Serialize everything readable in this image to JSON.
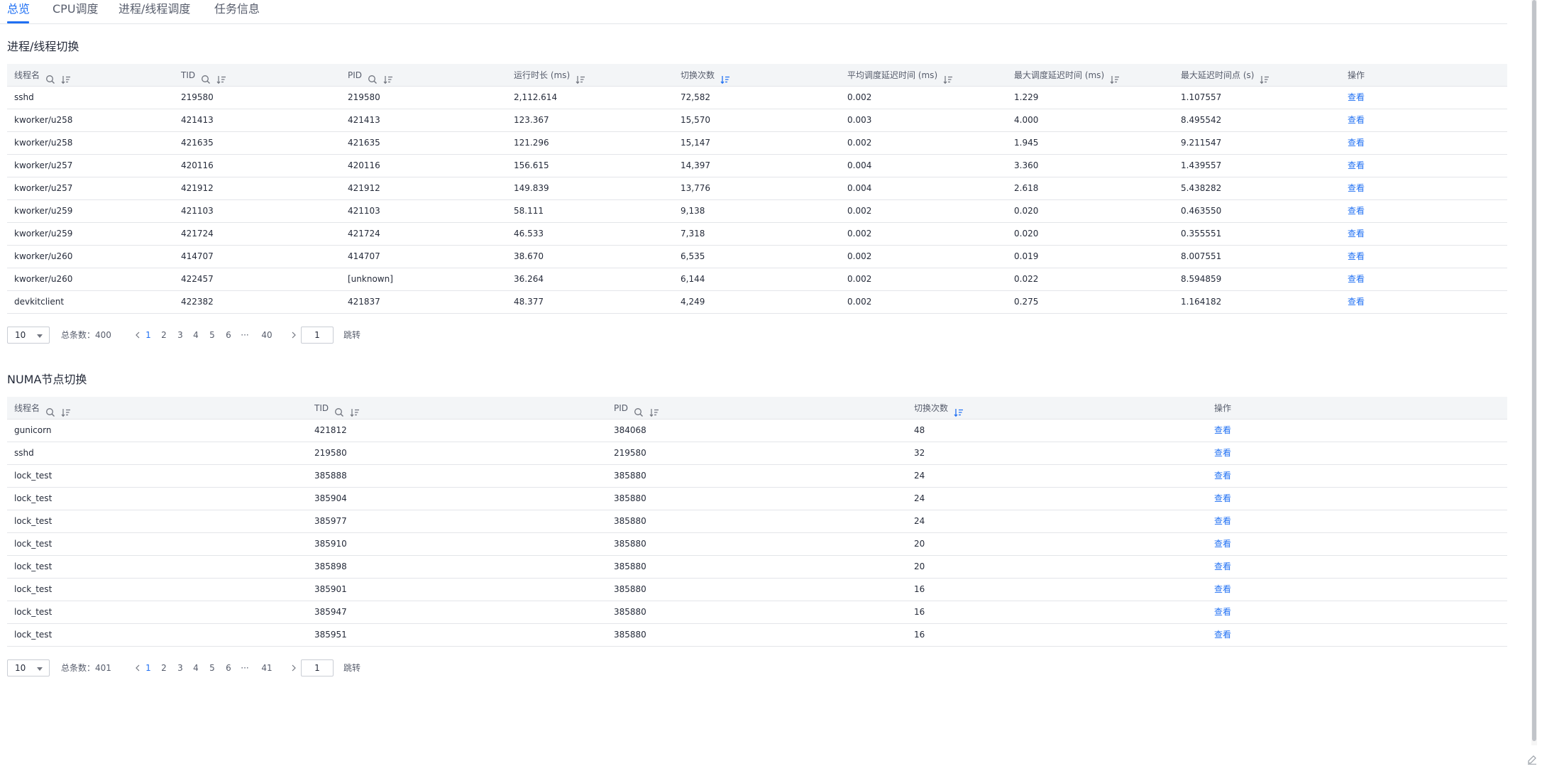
{
  "tabs": [
    {
      "label": "总览",
      "active": true
    },
    {
      "label": "CPU调度",
      "active": false
    },
    {
      "label": "进程/线程调度",
      "active": false
    },
    {
      "label": "任务信息",
      "active": false
    }
  ],
  "colors": {
    "accent": "#2070f3",
    "header_bg": "#f3f5f7",
    "border": "#e3e5e9",
    "text": "#252b3a",
    "muted": "#575d6c"
  },
  "switch_section": {
    "title": "进程/线程切换",
    "columns": [
      {
        "label": "线程名",
        "icons": [
          "search-icon",
          "sort-icon"
        ]
      },
      {
        "label": "TID",
        "icons": [
          "search-icon",
          "sort-icon"
        ]
      },
      {
        "label": "PID",
        "icons": [
          "search-icon",
          "sort-icon"
        ]
      },
      {
        "label": "运行时长 (ms)",
        "icons": [
          "sort-icon"
        ]
      },
      {
        "label": "切换次数",
        "icons": [
          "sort-desc-active-icon"
        ]
      },
      {
        "label": "平均调度延迟时间 (ms)",
        "icons": [
          "sort-icon"
        ]
      },
      {
        "label": "最大调度延迟时间 (ms)",
        "icons": [
          "sort-icon"
        ]
      },
      {
        "label": "最大延迟时间点 (s)",
        "icons": [
          "sort-icon"
        ]
      },
      {
        "label": "操作",
        "icons": []
      }
    ],
    "rows": [
      [
        "sshd",
        "219580",
        "219580",
        "2,112.614",
        "72,582",
        "0.002",
        "1.229",
        "1.107557",
        "查看"
      ],
      [
        "kworker/u258",
        "421413",
        "421413",
        "123.367",
        "15,570",
        "0.003",
        "4.000",
        "8.495542",
        "查看"
      ],
      [
        "kworker/u258",
        "421635",
        "421635",
        "121.296",
        "15,147",
        "0.002",
        "1.945",
        "9.211547",
        "查看"
      ],
      [
        "kworker/u257",
        "420116",
        "420116",
        "156.615",
        "14,397",
        "0.004",
        "3.360",
        "1.439557",
        "查看"
      ],
      [
        "kworker/u257",
        "421912",
        "421912",
        "149.839",
        "13,776",
        "0.004",
        "2.618",
        "5.438282",
        "查看"
      ],
      [
        "kworker/u259",
        "421103",
        "421103",
        "58.111",
        "9,138",
        "0.002",
        "0.020",
        "0.463550",
        "查看"
      ],
      [
        "kworker/u259",
        "421724",
        "421724",
        "46.533",
        "7,318",
        "0.002",
        "0.020",
        "0.355551",
        "查看"
      ],
      [
        "kworker/u260",
        "414707",
        "414707",
        "38.670",
        "6,535",
        "0.002",
        "0.019",
        "8.007551",
        "查看"
      ],
      [
        "kworker/u260",
        "422457",
        "[unknown]",
        "36.264",
        "6,144",
        "0.002",
        "0.022",
        "8.594859",
        "查看"
      ],
      [
        "devkitclient",
        "422382",
        "421837",
        "48.377",
        "4,249",
        "0.002",
        "0.275",
        "1.164182",
        "查看"
      ]
    ],
    "pager": {
      "page_size": "10",
      "total_label": "总条数：400",
      "prev_icon": "chevron-left-icon",
      "next_icon": "chevron-right-icon",
      "pages": [
        "1",
        "2",
        "3",
        "4",
        "5",
        "6",
        "···",
        "40"
      ],
      "jump_value": "1",
      "jump_label": "跳转"
    }
  },
  "numa_section": {
    "title": "NUMA节点切换",
    "columns": [
      {
        "label": "线程名",
        "icons": [
          "search-icon",
          "sort-icon"
        ]
      },
      {
        "label": "TID",
        "icons": [
          "search-icon",
          "sort-icon"
        ]
      },
      {
        "label": "PID",
        "icons": [
          "search-icon",
          "sort-icon"
        ]
      },
      {
        "label": "切换次数",
        "icons": [
          "sort-desc-active-icon"
        ]
      },
      {
        "label": "操作",
        "icons": []
      }
    ],
    "rows": [
      [
        "gunicorn",
        "421812",
        "384068",
        "48",
        "查看"
      ],
      [
        "sshd",
        "219580",
        "219580",
        "32",
        "查看"
      ],
      [
        "lock_test",
        "385888",
        "385880",
        "24",
        "查看"
      ],
      [
        "lock_test",
        "385904",
        "385880",
        "24",
        "查看"
      ],
      [
        "lock_test",
        "385977",
        "385880",
        "24",
        "查看"
      ],
      [
        "lock_test",
        "385910",
        "385880",
        "20",
        "查看"
      ],
      [
        "lock_test",
        "385898",
        "385880",
        "20",
        "查看"
      ],
      [
        "lock_test",
        "385901",
        "385880",
        "16",
        "查看"
      ],
      [
        "lock_test",
        "385947",
        "385880",
        "16",
        "查看"
      ],
      [
        "lock_test",
        "385951",
        "385880",
        "16",
        "查看"
      ]
    ],
    "pager": {
      "page_size": "10",
      "total_label": "总条数：401",
      "prev_icon": "chevron-left-icon",
      "next_icon": "chevron-right-icon",
      "pages": [
        "1",
        "2",
        "3",
        "4",
        "5",
        "6",
        "···",
        "41"
      ],
      "jump_value": "1",
      "jump_label": "跳转"
    }
  }
}
